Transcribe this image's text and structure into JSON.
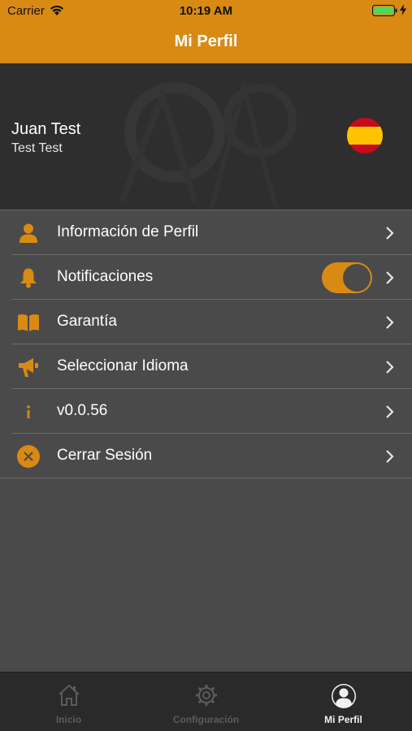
{
  "status_bar": {
    "carrier": "Carrier",
    "time": "10:19 AM"
  },
  "nav": {
    "title": "Mi Perfil"
  },
  "profile": {
    "name": "Juan Test",
    "subtitle": "Test Test",
    "flag_icon": "spain-flag-icon"
  },
  "menu": {
    "items": [
      {
        "label": "Información de Perfil",
        "icon": "person-icon"
      },
      {
        "label": "Notificaciones",
        "icon": "bell-icon",
        "toggle_on": true
      },
      {
        "label": "Garantía",
        "icon": "book-icon"
      },
      {
        "label": "Seleccionar Idioma",
        "icon": "megaphone-icon"
      },
      {
        "label": "v0.0.56",
        "icon": "info-icon"
      },
      {
        "label": "Cerrar Sesión",
        "icon": "close-circle-icon"
      }
    ]
  },
  "tabbar": {
    "tabs": [
      {
        "label": "Inicio",
        "icon": "home-icon",
        "active": false
      },
      {
        "label": "Configuración",
        "icon": "gear-icon",
        "active": false
      },
      {
        "label": "Mi Perfil",
        "icon": "profile-icon",
        "active": true
      }
    ]
  },
  "colors": {
    "accent": "#d98a13",
    "background": "#4a4a4a",
    "header": "#2e2e2e",
    "tabbar": "#2a2a2a"
  }
}
